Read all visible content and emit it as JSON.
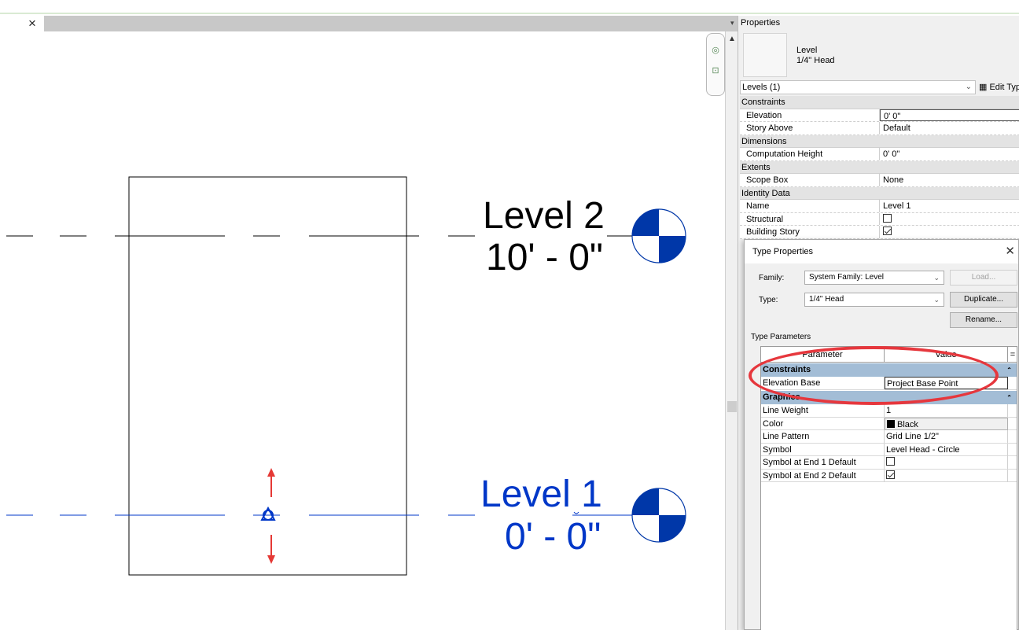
{
  "view": {
    "close_tab_label": "×",
    "levels": [
      {
        "name": "Level 2",
        "elevation": "10' - 0\"",
        "color": "#000000"
      },
      {
        "name": "Level 1",
        "elevation": "0' - 0\"",
        "color": "#0037c8"
      }
    ]
  },
  "properties": {
    "title": "Properties",
    "type_family": "Level",
    "type_name": "1/4\" Head",
    "instance_selector": "Levels (1)",
    "edit_type_label": "Edit Typ",
    "groups": {
      "constraints": "Constraints",
      "dimensions": "Dimensions",
      "extents": "Extents",
      "identity": "Identity Data"
    },
    "rows": {
      "elevation": {
        "name": "Elevation",
        "value": "0'  0\""
      },
      "story_above": {
        "name": "Story Above",
        "value": "Default"
      },
      "computation_height": {
        "name": "Computation Height",
        "value": "0'  0\""
      },
      "scope_box": {
        "name": "Scope Box",
        "value": "None"
      },
      "name": {
        "name": "Name",
        "value": "Level 1"
      },
      "structural": {
        "name": "Structural",
        "checked": false
      },
      "building_story": {
        "name": "Building Story",
        "checked": true
      }
    }
  },
  "type_properties": {
    "title": "Type Properties",
    "family_label": "Family:",
    "family_value": "System Family: Level",
    "type_label": "Type:",
    "type_value": "1/4\" Head",
    "load_button": "Load...",
    "duplicate_button": "Duplicate...",
    "rename_button": "Rename...",
    "section_label": "Type Parameters",
    "col_parameter": "Parameter",
    "col_value": "Value",
    "col_extra": "=",
    "groups": {
      "constraints": "Constraints",
      "graphics": "Graphics"
    },
    "rows": {
      "elevation_base": {
        "name": "Elevation Base",
        "value": "Project Base Point"
      },
      "line_weight": {
        "name": "Line Weight",
        "value": "1"
      },
      "color": {
        "name": "Color",
        "value": "Black",
        "swatch": "#000000"
      },
      "line_pattern": {
        "name": "Line Pattern",
        "value": "Grid Line 1/2\""
      },
      "symbol": {
        "name": "Symbol",
        "value": "Level Head - Circle"
      },
      "symbol_end1": {
        "name": "Symbol at End 1 Default",
        "checked": false
      },
      "symbol_end2": {
        "name": "Symbol at End 2 Default",
        "checked": true
      }
    }
  },
  "colors": {
    "highlight": "#e6373d",
    "level_head_fill": "#0037a8",
    "selected_level": "#0037c8",
    "group_header": "#a3bdd6"
  }
}
